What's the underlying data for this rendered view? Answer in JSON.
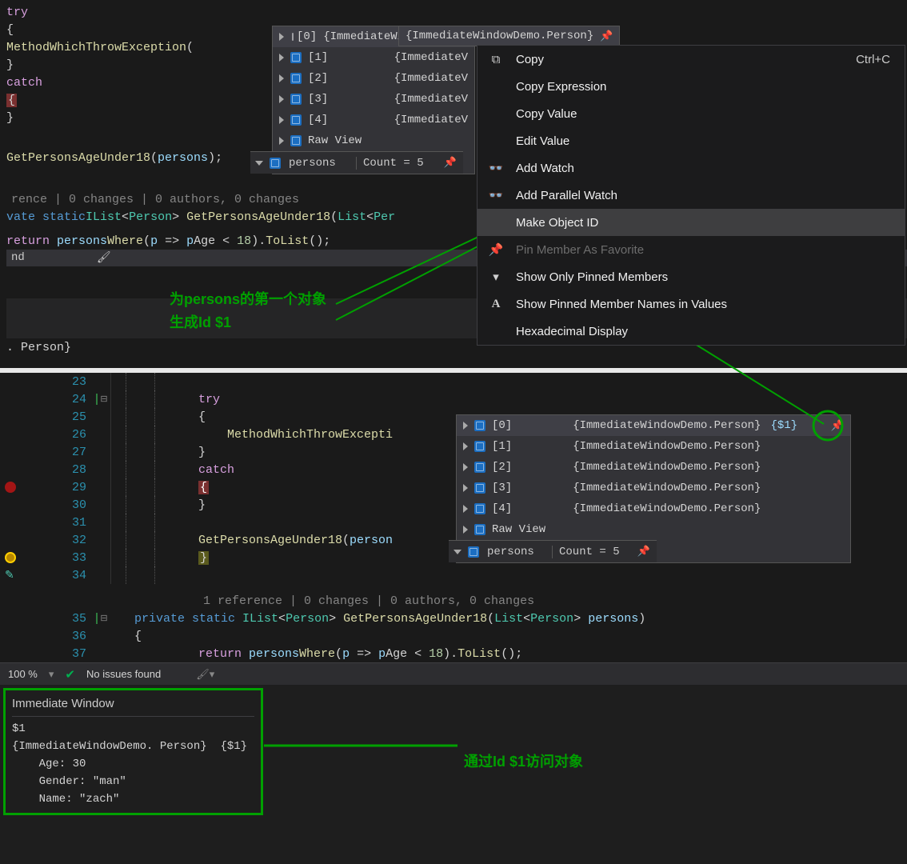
{
  "top": {
    "line1": {
      "kw": "try"
    },
    "line2": "{",
    "line3": {
      "fn": "MethodWhichThrowException",
      "p1": "("
    },
    "line4": "}",
    "line5": {
      "kw": "catch"
    },
    "line6_brace": "{",
    "line7": "}",
    "line8": {
      "fn": "GetPersonsAgeUnder18",
      "args": "persons",
      "end": ");"
    },
    "codelens": "rence | 0 changes | 0 authors, 0 changes",
    "sig": {
      "mod": "vate ",
      "kw": "static",
      "sp": " ",
      "ilist": "IList",
      "lt": "<",
      "person": "Person",
      "gt": ">",
      "fn": " GetPersonsAgeUnder18",
      "p1": "(",
      "list": "List",
      "lt2": "<",
      "p2": "Per"
    },
    "ret": {
      "kw": "return",
      "sp": " ",
      "var": "persons",
      ".w": ".",
      "where": "Where",
      "p": "(",
      "lam": "p ",
      "op": "=>",
      "sp2": " ",
      "v2": "p",
      ".a": ".",
      "age": "Age ",
      "lt": "< ",
      "num": "18",
      "cp": ").",
      "tl": "ToList",
      "e": "();"
    },
    "bottom_line": ". Person}",
    "nd": "nd",
    "brush": "🖌"
  },
  "datatip1": {
    "rows": [
      {
        "idx": "[0]",
        "val": "{ImmediateWindowDemo.Person}"
      },
      {
        "idx": "[1]",
        "val": "{ImmediateV"
      },
      {
        "idx": "[2]",
        "val": "{ImmediateV"
      },
      {
        "idx": "[3]",
        "val": "{ImmediateV"
      },
      {
        "idx": "[4]",
        "val": "{ImmediateV"
      }
    ],
    "raw": "Raw View",
    "footer": {
      "name": "persons",
      "count": "Count = 5"
    }
  },
  "ctx": {
    "items": [
      {
        "icon": "copy",
        "label": "Copy",
        "short": "Ctrl+C"
      },
      {
        "icon": "",
        "label": "Copy Expression"
      },
      {
        "icon": "",
        "label": "Copy Value"
      },
      {
        "icon": "",
        "label": "Edit Value"
      },
      {
        "icon": "watch",
        "label": "Add Watch"
      },
      {
        "icon": "watch",
        "label": "Add Parallel Watch"
      },
      {
        "icon": "",
        "label": "Make Object ID",
        "hl": true
      },
      {
        "icon": "pin",
        "label": "Pin Member As Favorite",
        "disabled": true
      },
      {
        "icon": "filter",
        "label": "Show Only Pinned Members"
      },
      {
        "icon": "A",
        "label": "Show Pinned Member Names in Values"
      },
      {
        "icon": "",
        "label": "Hexadecimal Display"
      }
    ]
  },
  "anno1_l1": "为persons的第一个对象",
  "anno1_l2": "生成Id $1",
  "lower": {
    "codelens": "1 reference | 0 changes | 0 authors, 0 changes",
    "lines": [
      {
        "n": 23
      },
      {
        "n": 24,
        "txt": [
          {
            "c": "tok-pink",
            "t": "try"
          }
        ]
      },
      {
        "n": 25,
        "txt": [
          {
            "c": "",
            "t": "{"
          }
        ]
      },
      {
        "n": 26,
        "txt": [
          {
            "c": "",
            "t": "    "
          },
          {
            "c": "tok-fn",
            "t": "MethodWhichThrowExcepti"
          }
        ]
      },
      {
        "n": 27,
        "txt": [
          {
            "c": "",
            "t": "}"
          }
        ]
      },
      {
        "n": 28,
        "txt": [
          {
            "c": "tok-pink",
            "t": "catch"
          }
        ]
      },
      {
        "n": 29,
        "bp": true,
        "txt": [
          {
            "c": "",
            "t": "{"
          }
        ],
        "hlbrace": true
      },
      {
        "n": 30,
        "txt": [
          {
            "c": "",
            "t": "}"
          }
        ]
      },
      {
        "n": 31
      },
      {
        "n": 32,
        "txt": [
          {
            "c": "tok-fn",
            "t": "GetPersonsAgeUnder18"
          },
          {
            "c": "",
            "t": "("
          },
          {
            "c": "tok-param",
            "t": "person"
          }
        ]
      },
      {
        "n": 33,
        "bpg": true,
        "txt": [
          {
            "c": "",
            "t": "}"
          }
        ],
        "ybrace": true
      },
      {
        "n": 34,
        "pen": true
      }
    ],
    "sig_n": 35,
    "line36_n": 36,
    "line37_n": 37,
    "line36_txt": "{",
    "sig": {
      "priv": "private ",
      "stat": "static ",
      "ilist": "IList",
      "lt": "<",
      "person": "Person",
      "gt": "> ",
      "fn": "GetPersonsAgeUnder18",
      "p": "(",
      "list": "List",
      "lt2": "<",
      "p2": "Person",
      "gt2": "> ",
      "arg": "persons",
      "cp": ")"
    },
    "ret": {
      "kw": "return ",
      "v": "persons",
      ".": ".",
      "w": "Where",
      "p": "(",
      "lam": "p ",
      "op": "=> ",
      "v2": "p",
      ".a": ".",
      "age": "Age ",
      "lt": "< ",
      "num": "18",
      "cp": ").",
      "tl": "ToList",
      "e": "();"
    }
  },
  "datatip2": {
    "rows": [
      {
        "idx": "[0]",
        "val": "{ImmediateWindowDemo.Person}",
        "oid": "{$1}"
      },
      {
        "idx": "[1]",
        "val": "{ImmediateWindowDemo.Person}"
      },
      {
        "idx": "[2]",
        "val": "{ImmediateWindowDemo.Person}"
      },
      {
        "idx": "[3]",
        "val": "{ImmediateWindowDemo.Person}"
      },
      {
        "idx": "[4]",
        "val": "{ImmediateWindowDemo.Person}"
      }
    ],
    "raw": "Raw View",
    "footer": {
      "name": "persons",
      "count": "Count = 5"
    }
  },
  "status": {
    "zoom": "100 %",
    "noissues": "No issues found"
  },
  "imm": {
    "title": "Immediate Window",
    "l1": "$1",
    "l2": "{ImmediateWindowDemo. Person}  {$1}",
    "l3": "    Age: 30",
    "l4": "    Gender: \"man\"",
    "l5": "    Name: \"zach\""
  },
  "anno2": "通过Id $1访问对象"
}
